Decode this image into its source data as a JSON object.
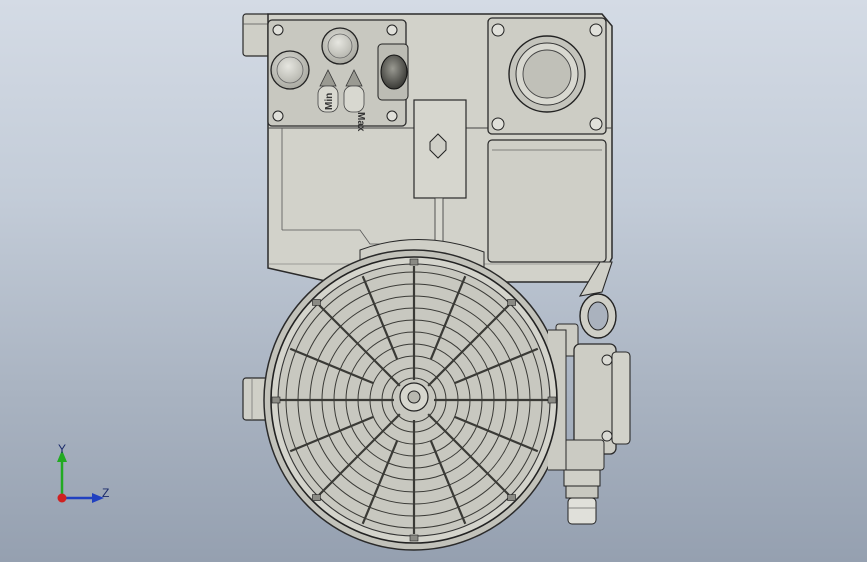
{
  "scene": {
    "background_top": "#d4dbe5",
    "background_bottom": "#95a0b0",
    "model_fill": "#d2d2ca",
    "model_stroke": "#2a2a2a",
    "grille_fill": "#c6c6be"
  },
  "labels": {
    "min_label": "Min",
    "max_label": "Max"
  },
  "triad": {
    "y_label": "Y",
    "z_label": "Z",
    "y_color": "#22aa22",
    "z_color": "#2040c0",
    "x_color": "#d02020"
  }
}
